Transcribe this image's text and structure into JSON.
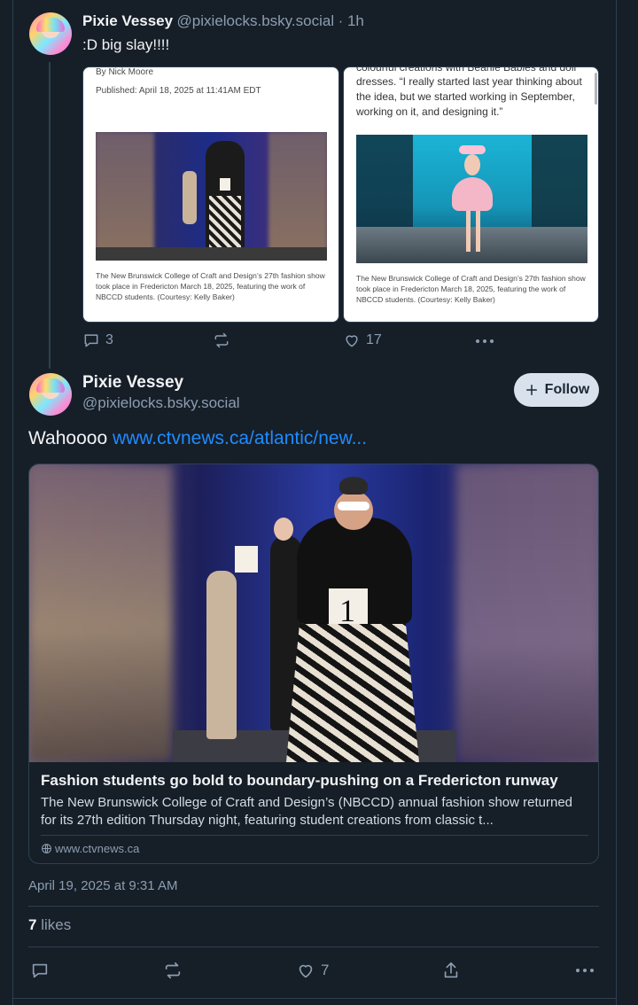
{
  "parent_post": {
    "display_name": "Pixie Vessey",
    "handle": "@pixielocks.bsky.social",
    "time": "· 1h",
    "text": ":D big slay!!!!",
    "image_left": {
      "byline": "By Nick Moore",
      "published": "Published: April 18, 2025 at 11:41AM EDT",
      "caption": "The New Brunswick College of Craft and Design’s 27th fashion show took place in Fredericton March 18, 2025, featuring the work of NBCCD students. (Courtesy: Kelly Baker)"
    },
    "image_right": {
      "top_partial": "colourful creations with Beanie Babies and doll",
      "quote": "dresses. “I really started last year thinking about the idea, but we started working in September, working on it, and designing it.”",
      "caption": "The New Brunswick College of Craft and Design’s 27th fashion show took place in Fredericton March 18, 2025, featuring the work of NBCCD students. (Courtesy: Kelly Baker)"
    },
    "reply_count": "3",
    "repost_count": "",
    "like_count": "17"
  },
  "main_post": {
    "display_name": "Pixie Vessey",
    "handle": "@pixielocks.bsky.social",
    "follow_label": "Follow",
    "text_prefix": "Wahoooo ",
    "link_text": "www.ctvnews.ca/atlantic/new...",
    "link_card": {
      "title": "Fashion students go bold to boundary-pushing on a Fredericton runway",
      "description": "The New Brunswick College of Craft and Design’s (NBCCD) annual fashion show returned for its 27th edition Thursday night, featuring student creations from classic t...",
      "domain": "www.ctvnews.ca"
    },
    "timestamp": "April 19, 2025 at 9:31 AM",
    "likes_count": "7",
    "likes_label": " likes",
    "like_action_count": "7"
  },
  "colors": {
    "background": "#161e27",
    "border": "#2e4052",
    "muted": "#8c9eb2",
    "link": "#208bfe",
    "follow_bg": "#d8e1ec"
  },
  "icons": [
    "reply-icon",
    "repost-icon",
    "like-icon",
    "more-icon",
    "plus-icon",
    "share-icon",
    "globe-icon"
  ]
}
